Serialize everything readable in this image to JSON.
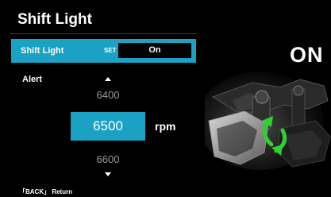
{
  "header": {
    "title": "Shift Light"
  },
  "menu_row": {
    "label": "Shift Light",
    "set_tag": "SET",
    "value": "On"
  },
  "alert": {
    "label": "Alert",
    "unit": "rpm",
    "values": {
      "prev": "6400",
      "current": "6500",
      "next": "6600"
    }
  },
  "footer": {
    "hint": "「BACK」 Return"
  },
  "indicator": {
    "text": "ON"
  },
  "colors": {
    "accent": "#1aa1c4",
    "background": "#000000",
    "muted_text": "#9a9a9a",
    "arrow_green": "#2fd12f"
  },
  "icons": {
    "up": "triangle-up-icon",
    "down": "triangle-down-icon",
    "rotate": "rotate-arrows-icon"
  }
}
